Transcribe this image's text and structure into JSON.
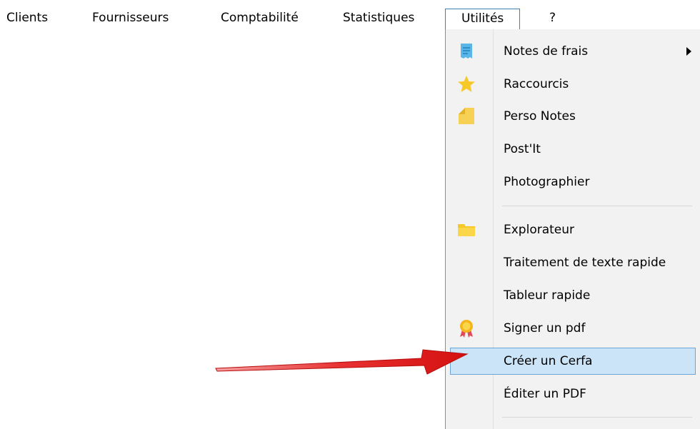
{
  "menubar": {
    "items": [
      "Clients",
      "Fournisseurs",
      "Comptabilité",
      "Statistiques",
      "Utilités",
      "?"
    ],
    "active_index": 4
  },
  "dropdown": {
    "items": [
      {
        "label": "Notes de frais",
        "icon": "receipt-icon",
        "submenu": true
      },
      {
        "label": "Raccourcis",
        "icon": "star-icon"
      },
      {
        "label": "Perso Notes",
        "icon": "sticky-note-icon"
      },
      {
        "label": "Post'It"
      },
      {
        "label": "Photographier"
      },
      {
        "label": "Explorateur",
        "icon": "folder-icon"
      },
      {
        "label": "Traitement de texte rapide"
      },
      {
        "label": "Tableur rapide"
      },
      {
        "label": "Signer un pdf",
        "icon": "certificate-icon"
      },
      {
        "label": "Créer un Cerfa",
        "highlighted": true
      },
      {
        "label": "Éditer un PDF"
      }
    ]
  },
  "colors": {
    "highlight_bg": "#cce4f7",
    "highlight_border": "#6ba5d6",
    "arrow_red": "#e31b1b",
    "icon_yellow": "#f7c928",
    "icon_blue": "#5bb6e8"
  }
}
